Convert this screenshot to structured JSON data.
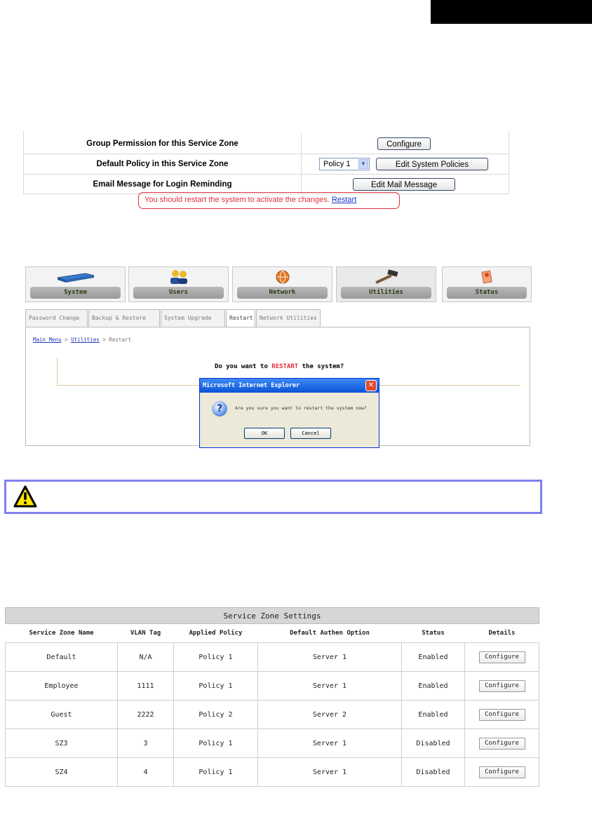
{
  "section1": {
    "rows": [
      {
        "label": "Group Permission for this Service Zone",
        "button": "Configure"
      },
      {
        "label": "Default Policy in this Service Zone",
        "select_value": "Policy 1",
        "button": "Edit System Policies"
      },
      {
        "label": "Email Message for Login Reminding",
        "button": "Edit Mail Message"
      }
    ],
    "notice": {
      "text": "You should restart the system to activate the changes.",
      "link": "Restart"
    }
  },
  "section2": {
    "nav_tabs": [
      {
        "label": "System",
        "icon": "switch-icon"
      },
      {
        "label": "Users",
        "icon": "users-icon"
      },
      {
        "label": "Network",
        "icon": "globe-icon"
      },
      {
        "label": "Utilities",
        "icon": "hammer-icon"
      },
      {
        "label": "Status",
        "icon": "status-icon"
      }
    ],
    "sub_tabs": [
      "Password Change",
      "Backup & Restore",
      "System Upgrade",
      "Restart",
      "Network Utilities"
    ],
    "breadcrumb": {
      "main": "Main Menu",
      "sep1": " > ",
      "section": "Utilities",
      "sep2": " > ",
      "current": "Restart"
    },
    "question": {
      "before": "Do you want to ",
      "highlight": "RESTART",
      "after": " the system?"
    },
    "dialog": {
      "title": "Microsoft Internet Explorer",
      "message": "Are you sure you want to restart the system now?",
      "ok": "OK",
      "cancel": "Cancel"
    }
  },
  "table": {
    "caption": "Service Zone Settings",
    "headers": [
      "Service Zone Name",
      "VLAN Tag",
      "Applied Policy",
      "Default Authen Option",
      "Status",
      "Details"
    ],
    "rows": [
      [
        "Default",
        "N/A",
        "Policy 1",
        "Server 1",
        "Enabled",
        "Configure"
      ],
      [
        "Employee",
        "1111",
        "Policy 1",
        "Server 1",
        "Enabled",
        "Configure"
      ],
      [
        "Guest",
        "2222",
        "Policy 2",
        "Server 2",
        "Enabled",
        "Configure"
      ],
      [
        "SZ3",
        "3",
        "Policy 1",
        "Server 1",
        "Disabled",
        "Configure"
      ],
      [
        "SZ4",
        "4",
        "Policy 1",
        "Server 1",
        "Disabled",
        "Configure"
      ]
    ]
  },
  "colors": {
    "notice_red": "#e2303b",
    "caution_border": "#8080ee",
    "link_blue": "#1b38c8"
  }
}
